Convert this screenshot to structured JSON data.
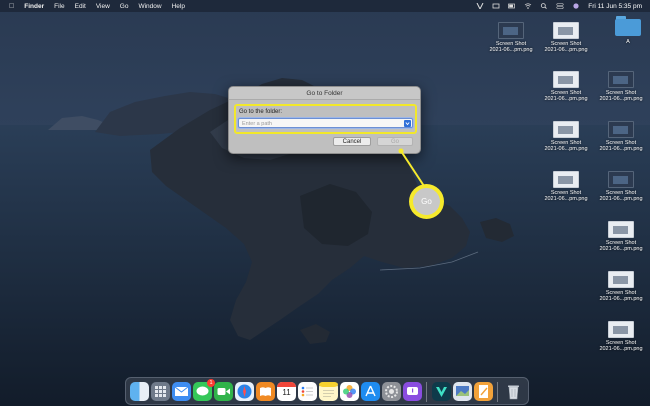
{
  "menubar": {
    "app_name": "Finder",
    "items": [
      "File",
      "Edit",
      "View",
      "Go",
      "Window",
      "Help"
    ],
    "clock": "Fri 11 Jun  5:35 pm"
  },
  "desktop": {
    "folder_label": "A",
    "screenshot_label": "Screen Shot",
    "screenshot_sub": "2021-06...pm.png"
  },
  "dialog": {
    "title": "Go to Folder",
    "label": "Go to the folder:",
    "placeholder": "Enter a path",
    "cancel_label": "Cancel",
    "go_label": "Go"
  },
  "callout": {
    "label": "Go"
  },
  "dock": {
    "apps": [
      "finder-icon",
      "launchpad-icon",
      "mail-icon",
      "messages-icon",
      "facetime-icon",
      "safari-icon",
      "books-icon",
      "calendar-icon",
      "reminders-icon",
      "notes-icon",
      "photos-icon",
      "app-store-icon",
      "system-preferences-icon",
      "feedback-icon",
      "vectornator-icon",
      "preview-icon",
      "pages-icon",
      "trash-icon"
    ],
    "calendar_day": "11",
    "badge_count": "1"
  }
}
